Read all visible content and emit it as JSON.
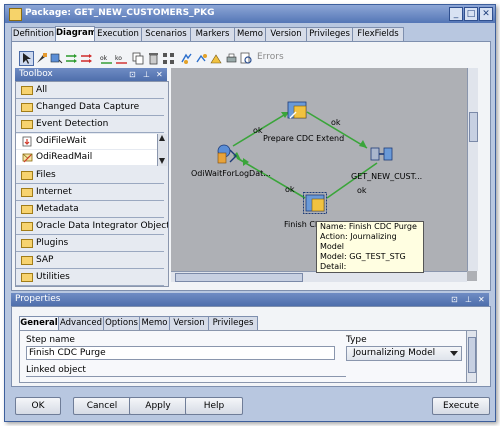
{
  "window": {
    "title": "Package: GET_NEW_CUSTOMERS_PKG",
    "minimize_glyph": "_",
    "maximize_glyph": "□",
    "close_glyph": "✕"
  },
  "top_tabs": [
    {
      "label": "Definition"
    },
    {
      "label": "Diagram"
    },
    {
      "label": "Execution"
    },
    {
      "label": "Scenarios"
    },
    {
      "label": "Markers"
    },
    {
      "label": "Memo"
    },
    {
      "label": "Version"
    },
    {
      "label": "Privileges"
    },
    {
      "label": "FlexFields"
    }
  ],
  "toolbar": {
    "errors_label": "Errors"
  },
  "toolbox": {
    "title": "Toolbox",
    "items": [
      {
        "label": "All"
      },
      {
        "label": "Changed Data Capture"
      },
      {
        "label": "Event Detection"
      },
      {
        "label": "OdiFileWait"
      },
      {
        "label": "OdiReadMail"
      },
      {
        "label": "Files"
      },
      {
        "label": "Internet"
      },
      {
        "label": "Metadata"
      },
      {
        "label": "Oracle Data Integrator Objects"
      },
      {
        "label": "Plugins"
      },
      {
        "label": "SAP"
      },
      {
        "label": "Utilities"
      }
    ]
  },
  "diagram": {
    "nodes": [
      {
        "label": "OdiWaitForLogDat..."
      },
      {
        "label": "Prepare CDC Extend"
      },
      {
        "label": "GET_NEW_CUST..."
      },
      {
        "label": "Finish CDC"
      }
    ],
    "link_labels": [
      "ok",
      "ok",
      "ok",
      "ok"
    ],
    "tooltip": {
      "name": "Name: Finish CDC Purge",
      "action": "Action: Journalizing Model",
      "model": "Model: GG_TEST_STG",
      "detail": "Detail:"
    }
  },
  "properties": {
    "title": "Properties",
    "tabs": [
      {
        "label": "General"
      },
      {
        "label": "Advanced"
      },
      {
        "label": "Options"
      },
      {
        "label": "Memo"
      },
      {
        "label": "Version"
      },
      {
        "label": "Privileges"
      }
    ],
    "step_name_label": "Step name",
    "step_name_value": "Finish CDC Purge",
    "type_label": "Type",
    "type_value": "Journalizing Model",
    "linked_object_label": "Linked object"
  },
  "buttons": {
    "ok": "OK",
    "cancel": "Cancel",
    "apply": "Apply",
    "help": "Help",
    "execute": "Execute"
  },
  "colors": {
    "title_blue": "#5476b6",
    "link_green": "#3aa53a",
    "canvas_gray": "#aeb0b5"
  }
}
